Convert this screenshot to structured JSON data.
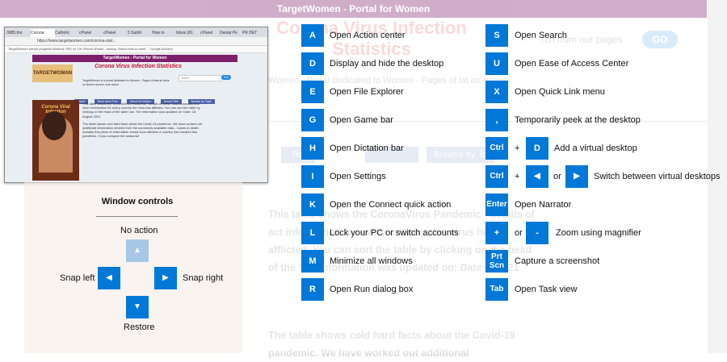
{
  "background_page": {
    "banner": "TargetWomen - Portal for Women",
    "title": "Corona Virus Infection Statistics",
    "search_hint": "rch from our pages",
    "go_label": "GO",
    "subtitle": "Women - Portal dedicated to Women - Pages of lat on issues",
    "tabs": [
      "Re",
      "Browse by To"
    ],
    "body": "This table shows the CoronaVirus Pandemic - details of act information for every country this virus has afflicted. You can sort the table by clicking on the head of the The information was updated on: Date: 1 2021",
    "body2": "The table shows cold hard facts about the Covid-19 pandemic. We have worked out additional"
  },
  "thumbnail": {
    "tabs": [
      "0085.tho",
      "Corona",
      "Catholic",
      "cPanel",
      "cPanel",
      "5 Subtit",
      "How to",
      "Inbox (81",
      "cPanel",
      "Dental Pe",
      "PR DET"
    ],
    "url": "https://www.targetwomen.com/corona-stat...",
    "bookmarks": "TargetWomen (demo   pluginlist   Webinar   TBS on TW   cPanel   cPanel - backup   Select How to reset  ...  Google  Bundes",
    "header": "TargetWomen - Portal for Women",
    "logo": "TARGETWOMAN",
    "title": "Corona Virus Infection Statistics",
    "sub": "TargetWomen is a portal dedicated to Women - Pages of lateral value on issues women care about",
    "search_placeholder": "search",
    "go": "GO",
    "navs": [
      "Home",
      "Book store Free",
      "About the Author",
      "Sound Files",
      "Browse by Topic"
    ],
    "side_title": "Corona Viral Infection",
    "para1": "This table shows the CoronaVirus Pandemic - details of active cases,casualty and other information for every country the virus has afflicted. You can sort the table by clicking on the head of the table row. The information was updated on: Date: 18 August 2021",
    "para2": "The table shows cold hard facts about the Covid-19 pandemic. We have worked out additional information derived from the commonly available data - Cases to death. Actually this piece of information shows how effective a country has handled this pandemic. If you compare the seasonal"
  },
  "window_controls": {
    "title": "Window controls",
    "no_action": "No action",
    "snap_left": "Snap left",
    "snap_right": "Snap right",
    "restore": "Restore",
    "arrow_up": "▲",
    "arrow_left": "◀",
    "arrow_right": "▶",
    "arrow_down": "▼"
  },
  "shortcuts_left": [
    {
      "key": "A",
      "label": "Open Action center"
    },
    {
      "key": "D",
      "label": "Display and hide the desktop"
    },
    {
      "key": "E",
      "label": "Open File Explorer"
    },
    {
      "key": "G",
      "label": "Open Game bar"
    },
    {
      "key": "H",
      "label": "Open Dictation bar"
    },
    {
      "key": "I",
      "label": "Open Settings"
    },
    {
      "key": "K",
      "label": "Open the Connect quick action"
    },
    {
      "key": "L",
      "label": "Lock your PC or switch accounts"
    },
    {
      "key": "M",
      "label": "Minimize all windows"
    },
    {
      "key": "R",
      "label": "Open Run dialog box"
    }
  ],
  "shortcuts_right": {
    "s": {
      "key": "S",
      "label": "Open Search"
    },
    "u": {
      "key": "U",
      "label": "Open Ease of Access Center"
    },
    "x": {
      "key": "X",
      "label": "Open Quick Link menu"
    },
    "comma": {
      "key": ",",
      "label": "Temporarily peek at the desktop"
    },
    "ctrl_d": {
      "key1": "Ctrl",
      "plus": "+",
      "key2": "D",
      "label": "Add a virtual desktop"
    },
    "ctrl_arrows": {
      "key1": "Ctrl",
      "plus": "+",
      "left": "◀",
      "or": "or",
      "right": "▶",
      "label": "Switch between virtual desktops"
    },
    "enter": {
      "key": "Enter",
      "label": "Open Narrator"
    },
    "zoom": {
      "plus_key": "+",
      "or": "or",
      "minus_key": "-",
      "label": "Zoom using magnifier"
    },
    "prtscn": {
      "key_line1": "Prt",
      "key_line2": "Scn",
      "label": "Capture a screenshot"
    },
    "tab": {
      "key": "Tab",
      "label": "Open Task view"
    }
  },
  "colors": {
    "key_blue": "#0078d7",
    "key_disabled": "#a6c8e6",
    "banner": "#7d1e6b"
  }
}
